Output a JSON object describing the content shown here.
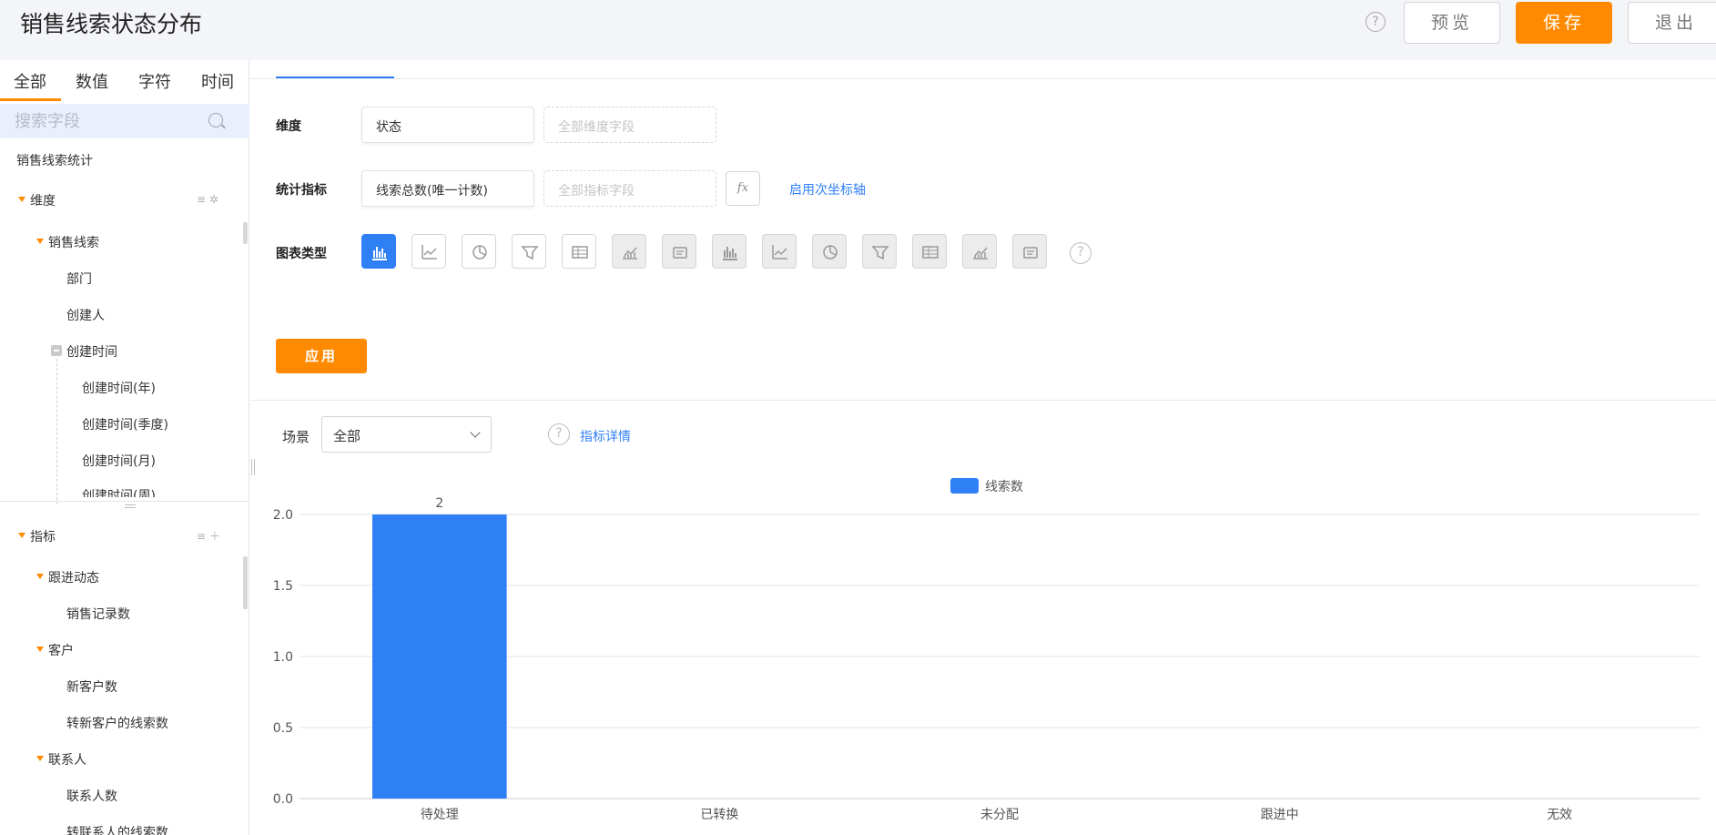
{
  "header": {
    "title": "销售线索状态分布",
    "help_icon": "?",
    "preview_label": "预览",
    "save_label": "保存",
    "exit_label": "退出",
    "accent": "#ff8a00"
  },
  "sidebar": {
    "tabs": [
      "全部",
      "数值",
      "字符",
      "时间"
    ],
    "active_tab": 0,
    "search_placeholder": "搜索字段",
    "dataset": "销售线索统计",
    "dimensions": {
      "label": "维度",
      "group": "销售线索",
      "items": [
        "部门",
        "创建人"
      ],
      "time_group": "创建时间",
      "time_items": [
        "创建时间(年)",
        "创建时间(季度)",
        "创建时间(月)",
        "创建时间(周)"
      ]
    },
    "metrics": {
      "label": "指标",
      "groups": [
        {
          "name": "跟进动态",
          "items": [
            "销售记录数"
          ]
        },
        {
          "name": "客户",
          "items": [
            "新客户数",
            "转新客户的线索数"
          ]
        },
        {
          "name": "联系人",
          "items": [
            "联系人数",
            "转联系人的线索数"
          ]
        }
      ]
    }
  },
  "config": {
    "dimension_label": "维度",
    "dimension_value": "状态",
    "dimension_placeholder": "全部维度字段",
    "metric_label": "统计指标",
    "metric_value": "线索总数(唯一计数)",
    "metric_placeholder": "全部指标字段",
    "fx_label": "fx",
    "secondary_axis_link": "启用次坐标轴",
    "chart_type_label": "图表类型",
    "chart_types": [
      "bar-chart-icon",
      "line-chart-icon",
      "pie-chart-icon",
      "funnel-chart-icon",
      "table-chart-icon",
      "area-chart-icon",
      "card-chart-icon",
      "gauge-chart-icon",
      "map-chart-icon",
      "bubble-map-icon",
      "stacked-bar-icon",
      "combo-line-icon",
      "heatmap-icon",
      "pivot-table-icon"
    ],
    "active_chart_type": 0,
    "apply_label": "应用",
    "link_color": "#2f7ff5"
  },
  "scene": {
    "label": "场景",
    "value": "全部",
    "details_link": "指标详情"
  },
  "chart_data": {
    "type": "bar",
    "categories": [
      "待处理",
      "已转换",
      "未分配",
      "跟进中",
      "无效"
    ],
    "series": [
      {
        "name": "线索数",
        "values": [
          2,
          0,
          0,
          0,
          0
        ],
        "color": "#2f7ff5"
      }
    ],
    "data_labels": [
      "2",
      "",
      "",
      "",
      ""
    ],
    "ylim": [
      0,
      2
    ],
    "yticks": [
      "2.0",
      "1.5",
      "1.0",
      "0.5",
      "0.0"
    ],
    "ytick_values": [
      2,
      1.5,
      1,
      0.5,
      0
    ],
    "legend": "top-center",
    "grid": true
  }
}
